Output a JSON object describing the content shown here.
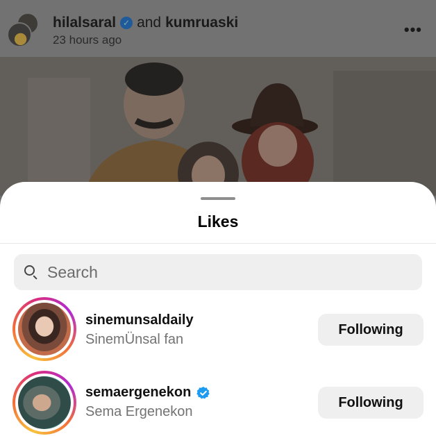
{
  "post": {
    "author_primary": "hilalsaral",
    "author_joiner": "and",
    "author_secondary": "kumruaski",
    "time": "23 hours ago",
    "more_icon": "more-horizontal-icon"
  },
  "sheet": {
    "title": "Likes",
    "search_placeholder": "Search"
  },
  "likes": [
    {
      "username": "sinemunsaldaily",
      "full_name": "SinemÜnsal fan",
      "verified": false,
      "button": "Following"
    },
    {
      "username": "semaergenekon",
      "full_name": "Sema Ergenekon",
      "verified": true,
      "button": "Following"
    }
  ],
  "colors": {
    "verified": "#1d9bf0",
    "button_bg": "#efefef",
    "dim_overlay": "#727272"
  }
}
